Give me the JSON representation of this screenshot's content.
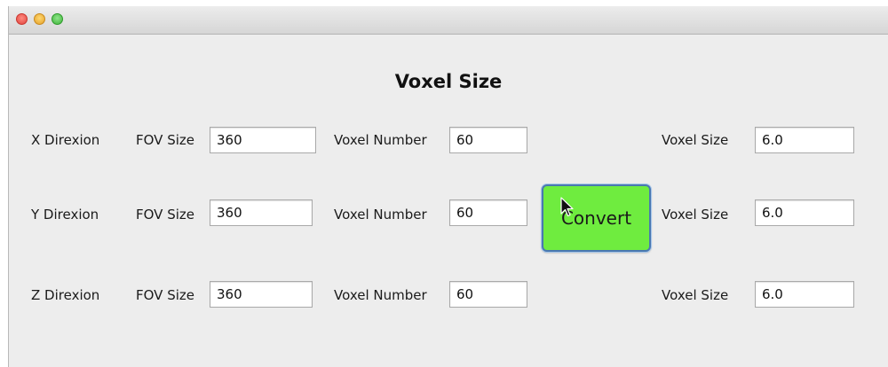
{
  "window": {
    "title_buttons": [
      "close",
      "minimize",
      "zoom"
    ]
  },
  "heading": "Voxel Size",
  "rows": [
    {
      "direction": "X Direxion",
      "fov_label": "FOV Size",
      "fov_value": "360",
      "voxel_number_label": "Voxel Number",
      "voxel_number_value": "60",
      "voxel_size_label": "Voxel Size",
      "voxel_size_value": "6.0"
    },
    {
      "direction": "Y Direxion",
      "fov_label": "FOV Size",
      "fov_value": "360",
      "voxel_number_label": "Voxel Number",
      "voxel_number_value": "60",
      "voxel_size_label": "Voxel Size",
      "voxel_size_value": "6.0"
    },
    {
      "direction": "Z Direxion",
      "fov_label": "FOV Size",
      "fov_value": "360",
      "voxel_number_label": "Voxel Number",
      "voxel_number_value": "60",
      "voxel_size_label": "Voxel Size",
      "voxel_size_value": "6.0"
    }
  ],
  "convert_button": {
    "label": "Convert",
    "color": "#6fec3f"
  },
  "colors": {
    "window_background": "#ededed",
    "button_border": "#4a78b0"
  },
  "icons": [
    "close-icon",
    "minimize-icon",
    "zoom-icon",
    "mouse-pointer-icon"
  ]
}
